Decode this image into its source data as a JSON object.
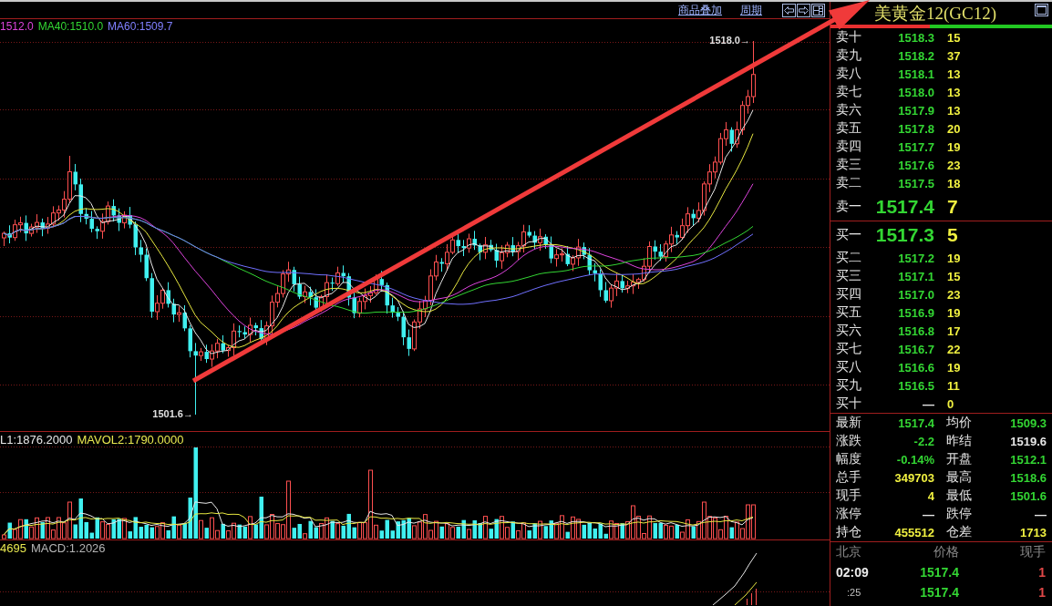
{
  "chart": {
    "toolbar": {
      "links": [
        "商品叠加",
        "周期"
      ]
    },
    "price_panel": {
      "ma_legend": [
        {
          "text": "1512.0",
          "color": "#dd44dd"
        },
        {
          "text": "MA40:1510.0",
          "color": "#33d633"
        },
        {
          "text": "MA60:1509.7",
          "color": "#8080ff"
        }
      ],
      "high_label": "1518.0→",
      "low_label": "1501.6→"
    },
    "volume_panel": {
      "legend": [
        {
          "text": "L1:1876.2000",
          "color": "#e8e8e8"
        },
        {
          "text": "MAVOL2:1790.0000",
          "color": "#e8e850"
        }
      ]
    },
    "macd_panel": {
      "legend": [
        {
          "text": "4695",
          "color": "#e8e850"
        },
        {
          "text": "MACD:1.2026",
          "color": "#b4b4b4"
        }
      ]
    }
  },
  "quote_panel": {
    "title": "美黄金12(GC12)",
    "ratio_bar": {
      "level": 0.45
    },
    "asks": [
      {
        "label": "卖十",
        "price": "1518.3",
        "volume": "15",
        "color": "#33d633"
      },
      {
        "label": "卖九",
        "price": "1518.2",
        "volume": "37",
        "color": "#33d633"
      },
      {
        "label": "卖八",
        "price": "1518.1",
        "volume": "13",
        "color": "#33d633"
      },
      {
        "label": "卖七",
        "price": "1518.0",
        "volume": "13",
        "color": "#33d633"
      },
      {
        "label": "卖六",
        "price": "1517.9",
        "volume": "13",
        "color": "#33d633"
      },
      {
        "label": "卖五",
        "price": "1517.8",
        "volume": "20",
        "color": "#33d633"
      },
      {
        "label": "卖四",
        "price": "1517.7",
        "volume": "19",
        "color": "#33d633"
      },
      {
        "label": "卖三",
        "price": "1517.6",
        "volume": "23",
        "color": "#33d633"
      },
      {
        "label": "卖二",
        "price": "1517.5",
        "volume": "18",
        "color": "#33d633"
      }
    ],
    "best_ask": {
      "label": "卖一",
      "price": "1517.4",
      "volume": "7"
    },
    "best_bid": {
      "label": "买一",
      "price": "1517.3",
      "volume": "5"
    },
    "bids": [
      {
        "label": "买二",
        "price": "1517.2",
        "volume": "19",
        "color": "#33d633"
      },
      {
        "label": "买三",
        "price": "1517.1",
        "volume": "15",
        "color": "#33d633"
      },
      {
        "label": "买四",
        "price": "1517.0",
        "volume": "23",
        "color": "#33d633"
      },
      {
        "label": "买五",
        "price": "1516.9",
        "volume": "19",
        "color": "#33d633"
      },
      {
        "label": "买六",
        "price": "1516.8",
        "volume": "17",
        "color": "#33d633"
      },
      {
        "label": "买七",
        "price": "1516.7",
        "volume": "22",
        "color": "#33d633"
      },
      {
        "label": "买八",
        "price": "1516.6",
        "volume": "19",
        "color": "#33d633"
      },
      {
        "label": "买九",
        "price": "1516.5",
        "volume": "11",
        "color": "#33d633"
      },
      {
        "label": "买十",
        "price": "—",
        "volume": "0",
        "color": "#e6e6e6"
      }
    ],
    "stats": [
      {
        "label": "最新",
        "value": "1517.4",
        "color": "#33d633"
      },
      {
        "label": "均价",
        "value": "1509.3",
        "color": "#33d633"
      },
      {
        "label": "涨跌",
        "value": "-2.2",
        "color": "#33d633"
      },
      {
        "label": "昨结",
        "value": "1519.6",
        "color": "#e6e6e6"
      },
      {
        "label": "幅度",
        "value": "-0.14%",
        "color": "#33d633"
      },
      {
        "label": "开盘",
        "value": "1512.1",
        "color": "#33d633"
      },
      {
        "label": "总手",
        "value": "349703",
        "color": "#f0f040"
      },
      {
        "label": "最高",
        "value": "1518.6",
        "color": "#33d633"
      },
      {
        "label": "现手",
        "value": "4",
        "color": "#f0f040"
      },
      {
        "label": "最低",
        "value": "1501.6",
        "color": "#33d633"
      },
      {
        "label": "涨停",
        "value": "—",
        "color": "#e6e6e6"
      },
      {
        "label": "跌停",
        "value": "—",
        "color": "#e6e6e6"
      },
      {
        "label": "持仓",
        "value": "455512",
        "color": "#f0f040"
      },
      {
        "label": "仓差",
        "value": "1713",
        "color": "#f0f040"
      }
    ],
    "trades": {
      "columns": [
        "北京",
        "价格",
        "现手"
      ],
      "rows": [
        {
          "time": "02:09",
          "price": "1517.4",
          "volume": "1",
          "kind": "minute"
        },
        {
          "time": ":25",
          "price": "1517.4",
          "volume": "1",
          "kind": "second"
        }
      ]
    }
  }
}
